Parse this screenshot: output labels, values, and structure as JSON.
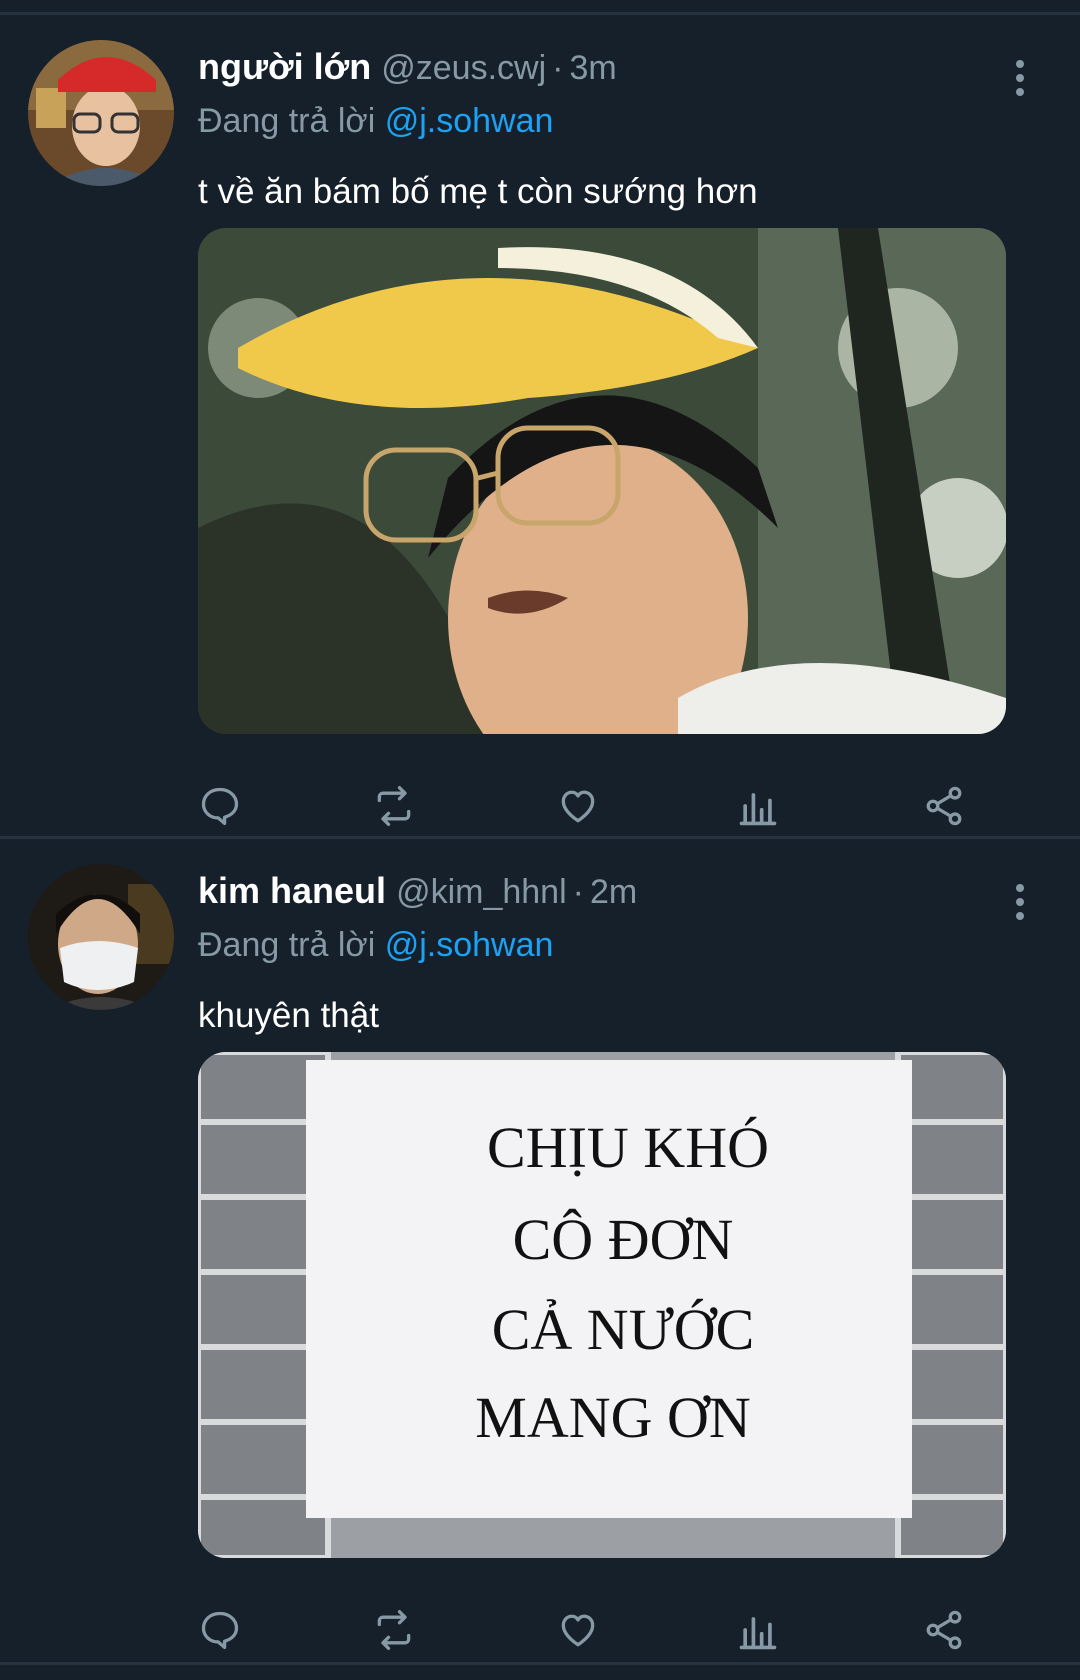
{
  "colors": {
    "background": "#15202b",
    "divider": "#253341",
    "secondary_text": "#8899a6",
    "mention": "#1da1f2"
  },
  "tweets": [
    {
      "name": "người lớn",
      "handle": "@zeus.cwj",
      "separator": "·",
      "time": "3m",
      "reply_prefix": "Đang trả lời",
      "reply_to": "@j.sohwan",
      "text": "t về ăn bám bố mẹ t còn sướng hơn",
      "media": "photo of man in yellow visor cap and glasses",
      "icons": [
        "reply-icon",
        "retweet-icon",
        "like-icon",
        "analytics-icon",
        "share-icon"
      ]
    },
    {
      "name": "kim haneul",
      "handle": "@kim_hhnl",
      "separator": "·",
      "time": "2m",
      "reply_prefix": "Đang trả lời",
      "reply_to": "@j.sohwan",
      "text": "khuyên thật",
      "media_sign_lines": [
        "CHỊU KHÓ",
        "CÔ ĐƠN",
        "CẢ NƯỚC",
        "MANG ƠN"
      ],
      "icons": [
        "reply-icon",
        "retweet-icon",
        "like-icon",
        "analytics-icon",
        "share-icon"
      ]
    }
  ]
}
